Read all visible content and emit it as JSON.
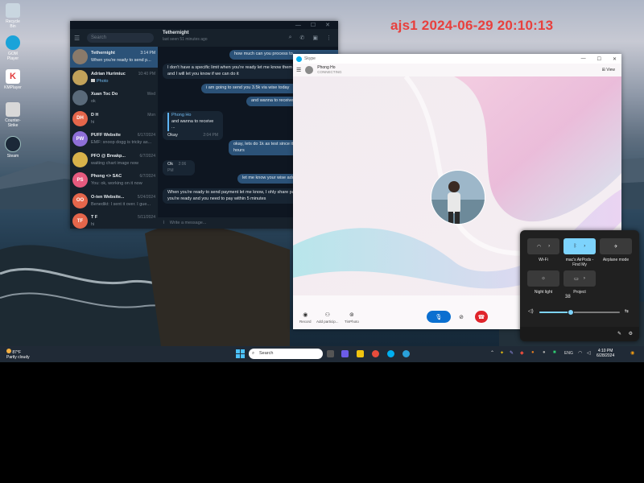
{
  "watermark": "ajs1 2024-06-29 20:10:13",
  "desktop_icons": [
    {
      "label": "Recycle Bin",
      "icon": "recycle-bin-icon",
      "color": "#c9d6e0"
    },
    {
      "label": "GOM Player",
      "icon": "media-player-icon",
      "color": "#1aa3d9"
    },
    {
      "label": "KMPlayer",
      "icon": "kmplayer-icon",
      "color": "#e23a3a"
    },
    {
      "label": "Counter-Strike",
      "icon": "cs-icon",
      "color": "#d8d8d8"
    },
    {
      "label": "Steam",
      "icon": "steam-icon",
      "color": "#1b2838"
    }
  ],
  "telegram": {
    "search_placeholder": "Search",
    "header": {
      "name": "Tethernight",
      "status": "last seen 51 minutes ago"
    },
    "chats": [
      {
        "initials": "",
        "name": "Tethernight",
        "time": "3:14 PM",
        "preview": "When you're ready to send p...",
        "color": "#8a7a6a",
        "active": true
      },
      {
        "initials": "",
        "name": "Adrian Hurimiuc",
        "time": "10:40 PM",
        "preview": "Photo",
        "color": "#c2a25a",
        "active": false
      },
      {
        "initials": "",
        "name": "Xuan Toc Do",
        "time": "Wed",
        "preview": "ok",
        "color": "#5a6a7a",
        "active": false
      },
      {
        "initials": "DH",
        "name": "D H",
        "time": "Mon",
        "preview": "hi",
        "color": "#e5664b",
        "active": false
      },
      {
        "initials": "PW",
        "name": "PUFF Website",
        "time": "6/17/2024",
        "preview": "EMF: snoop dogg is tricky as...",
        "color": "#8e6fd8",
        "active": false
      },
      {
        "initials": "",
        "name": "PFO @ Breakp...",
        "time": "6/7/2024",
        "preview": "waiting chart image now",
        "color": "#d8b24a",
        "active": false
      },
      {
        "initials": "PS",
        "name": "Phong <> SAC",
        "time": "6/7/2024",
        "preview": "You: ok, working on it now",
        "color": "#e65a7e",
        "active": false
      },
      {
        "initials": "OO",
        "name": "O-ten Website...",
        "time": "5/24/2024",
        "preview": "Benedikt: I sent it over. I gue...",
        "color": "#e5664b",
        "active": false
      },
      {
        "initials": "TF",
        "name": "T F",
        "time": "5/11/2024",
        "preview": "hi",
        "color": "#e5664b",
        "active": false
      }
    ],
    "messages": [
      {
        "dir": "out",
        "text": "how much can you process to"
      },
      {
        "dir": "in",
        "text": "I don't have a specific limit when you're ready let me know them what you need and I will let you know if we can do it"
      },
      {
        "dir": "out",
        "text": "i am going to send you 3.5k via wise today"
      },
      {
        "dir": "out",
        "text": "and wanna to receive"
      },
      {
        "dir": "in",
        "reply_name": "Phong Ho",
        "reply_text": "and wanna to receive ...",
        "text": "Okay",
        "time": "2:04 PM"
      },
      {
        "dir": "out",
        "text": "okay, lets do 1k as test since it I will back in a few hours"
      },
      {
        "dir": "in",
        "text": "Ok",
        "time": "2:06 PM"
      },
      {
        "dir": "out",
        "text": "let me know your wise add"
      },
      {
        "dir": "in",
        "text": "When you're ready to send payment let me know, I ohly share payment details when you're ready and you need to pay within 5 minutes"
      }
    ],
    "compose_placeholder": "Write a message..."
  },
  "skype": {
    "app_title": "Skype",
    "contact_name": "Phong Ho",
    "call_status": "CONNECTING",
    "view_label": "View",
    "actions": [
      {
        "label": "Record",
        "icon": "record-icon"
      },
      {
        "label": "Add particip...",
        "icon": "add-participant-icon"
      },
      {
        "label": "TinPhoto",
        "icon": "photo-icon"
      }
    ]
  },
  "quick_settings": {
    "tiles": [
      {
        "label": "Wi-Fi",
        "icon": "wifi-icon",
        "on": false
      },
      {
        "label": "mac's AirPods - Find My",
        "icon": "bluetooth-icon",
        "on": true
      },
      {
        "label": "Airplane mode",
        "icon": "airplane-icon",
        "on": false
      },
      {
        "label": "Night light",
        "icon": "night-light-icon",
        "on": false
      },
      {
        "label": "Project",
        "icon": "project-icon",
        "on": false
      }
    ],
    "volume_percent": 38
  },
  "taskbar": {
    "temperature": "87°F",
    "weather": "Partly cloudy",
    "search_placeholder": "Search",
    "language": "ENG",
    "time": "4:10 PM",
    "date": "6/28/2024"
  }
}
